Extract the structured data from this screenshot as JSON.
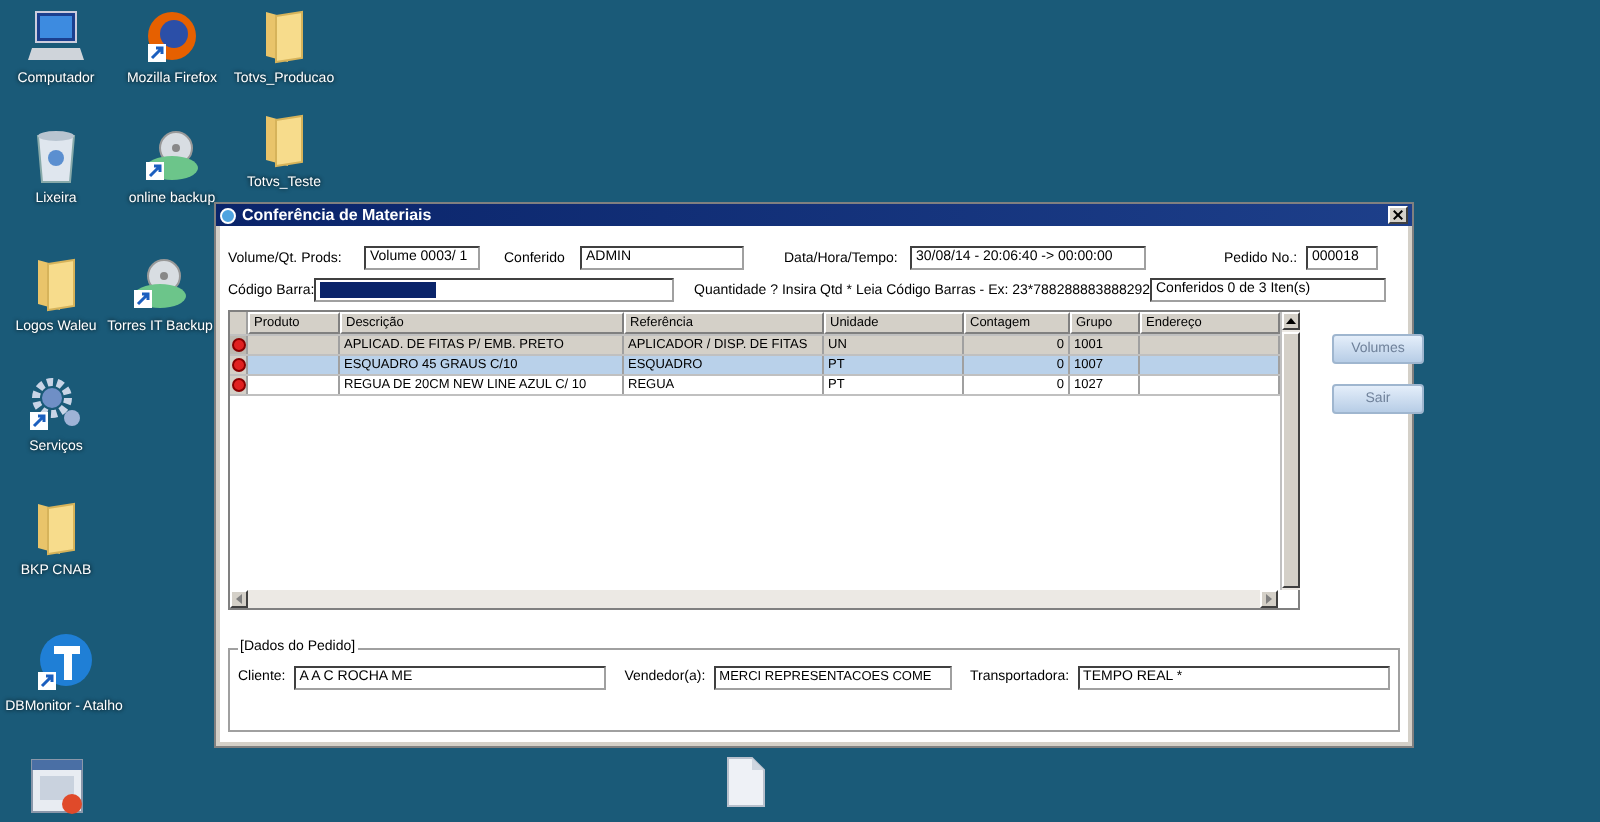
{
  "desktop_icons": [
    {
      "label": "Computador",
      "kind": "computer"
    },
    {
      "label": "Mozilla Firefox",
      "kind": "browser"
    },
    {
      "label": "Totvs_Producao",
      "kind": "folder"
    },
    {
      "label": "Lixeira",
      "kind": "trash"
    },
    {
      "label": "online backup",
      "kind": "cloud"
    },
    {
      "label": "Totvs_Teste",
      "kind": "folder"
    },
    {
      "label": "Logos Waleu",
      "kind": "folder"
    },
    {
      "label": "Torres IT Backup",
      "kind": "cloud"
    },
    {
      "label": "Serviços",
      "kind": "gears"
    },
    {
      "label": "BKP CNAB",
      "kind": "folder"
    },
    {
      "label": "DBMonitor - Atalho",
      "kind": "globe"
    },
    {
      "kind": "app"
    },
    {
      "kind": "file"
    }
  ],
  "window": {
    "title": "Conferência de Materiais",
    "header": {
      "volume_label": "Volume/Qt. Prods:",
      "volume": "Volume 0003/ 1",
      "conferido_label": "Conferido",
      "conferido": "ADMIN",
      "datetime_label": "Data/Hora/Tempo:",
      "datetime": "30/08/14 - 20:06:40 -> 00:00:00",
      "pedido_label": "Pedido No.:",
      "pedido": "000018",
      "barcode_label": "Código Barra:",
      "hint": "Quantidade ? Insira Qtd * Leia Código Barras - Ex: 23*788288883888292",
      "conferidos": "Conferidos   0 de   3 Iten(s)"
    },
    "table": {
      "columns": [
        "Produto",
        "Descrição",
        "Referência",
        "Unidade",
        "Contagem",
        "Grupo",
        "Endereço"
      ],
      "rows": [
        {
          "current": true,
          "selected": false,
          "cells": [
            "",
            "APLICAD. DE FITAS P/ EMB. PRETO",
            "APLICADOR / DISP. DE FITAS",
            "UN",
            "0",
            "1001",
            ""
          ]
        },
        {
          "current": false,
          "selected": true,
          "cells": [
            "",
            "ESQUADRO 45 GRAUS C/10",
            "ESQUADRO",
            "PT",
            "0",
            "1007",
            ""
          ]
        },
        {
          "current": false,
          "selected": false,
          "cells": [
            "",
            "REGUA DE 20CM NEW LINE AZUL C/ 10",
            "REGUA",
            "PT",
            "0",
            "1027",
            ""
          ]
        }
      ]
    },
    "buttons": [
      {
        "label": "Volumes",
        "disabled": true
      },
      {
        "label": "Sair",
        "disabled": true
      }
    ],
    "order": {
      "title": "[Dados do Pedido]",
      "cliente_label": "Cliente:",
      "cliente": "A A C ROCHA  ME",
      "vendedor_label": "Vendedor(a):",
      "vendedor": "MERCI REPRESENTACOES COME",
      "transportadora_label": "Transportadora:",
      "transportadora": "TEMPO REAL *"
    }
  }
}
